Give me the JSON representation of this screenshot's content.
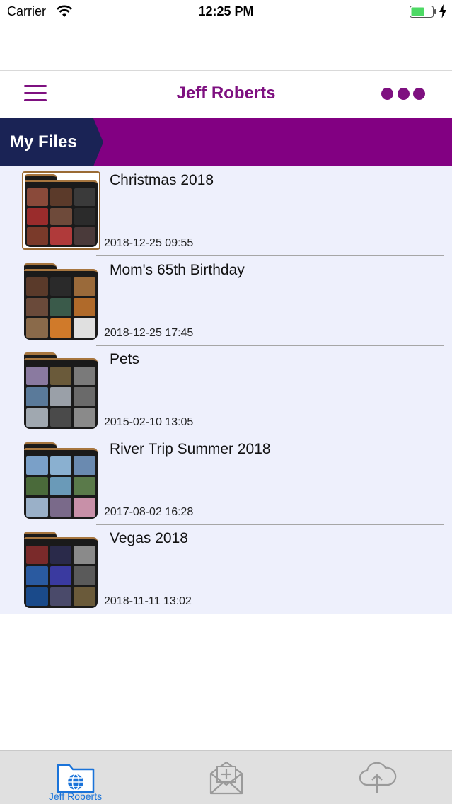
{
  "status_bar": {
    "carrier": "Carrier",
    "time": "12:25 PM",
    "battery_color": "#4cd964"
  },
  "header": {
    "title": "Jeff Roberts",
    "accent_color": "#7e1080",
    "menu_icon": "hamburger-icon",
    "more_icon": "more-dots-icon"
  },
  "section": {
    "label": "My Files",
    "banner_color": "#820082",
    "tab_color": "#1a2355"
  },
  "files": [
    {
      "name": "Christmas 2018",
      "date": "2018-12-25 09:55",
      "selected": true,
      "thumbs": [
        "#8a4a3a",
        "#5b3a2a",
        "#3a3a3a",
        "#9a2c2c",
        "#6e4a3a",
        "#2b2b2b",
        "#7a3a2a",
        "#b03a3a",
        "#4a3a3a"
      ]
    },
    {
      "name": "Mom's 65th Birthday",
      "date": "2018-12-25 17:45",
      "selected": false,
      "thumbs": [
        "#5a3a2a",
        "#2a2a2a",
        "#9a6a3a",
        "#6a4a3a",
        "#3a5a4a",
        "#b06a2a",
        "#8a6a4a",
        "#d07a2a",
        "#e0e0e0"
      ]
    },
    {
      "name": "Pets",
      "date": "2015-02-10 13:05",
      "selected": false,
      "thumbs": [
        "#8a7aa0",
        "#6a5a3a",
        "#7a7a7a",
        "#5a7a9a",
        "#9aa0a8",
        "#6a6a6a",
        "#a0a8b0",
        "#4a4a4a",
        "#8a8a8a"
      ]
    },
    {
      "name": "River Trip Summer 2018",
      "date": "2017-08-02 16:28",
      "selected": false,
      "thumbs": [
        "#7aa0c8",
        "#8ab0d0",
        "#6a8ab0",
        "#4a6a3a",
        "#6a9ab8",
        "#5a7a4a",
        "#9ab0c8",
        "#7a6a8a",
        "#c890a8"
      ]
    },
    {
      "name": "Vegas 2018",
      "date": "2018-11-11 13:02",
      "selected": false,
      "thumbs": [
        "#7a2a2a",
        "#2a2a4a",
        "#8a8a8a",
        "#2a5aa0",
        "#3a3aa0",
        "#5a5a5a",
        "#1a4a8a",
        "#4a4a6a",
        "#6a5a3a"
      ]
    }
  ],
  "tab_bar": {
    "items": [
      {
        "label": "Jeff Roberts",
        "icon": "folder-globe-icon",
        "active": true
      },
      {
        "label": "",
        "icon": "envelope-add-icon",
        "active": false
      },
      {
        "label": "",
        "icon": "cloud-upload-icon",
        "active": false
      }
    ],
    "active_color": "#1a73d9",
    "inactive_color": "#9a9a9a"
  }
}
